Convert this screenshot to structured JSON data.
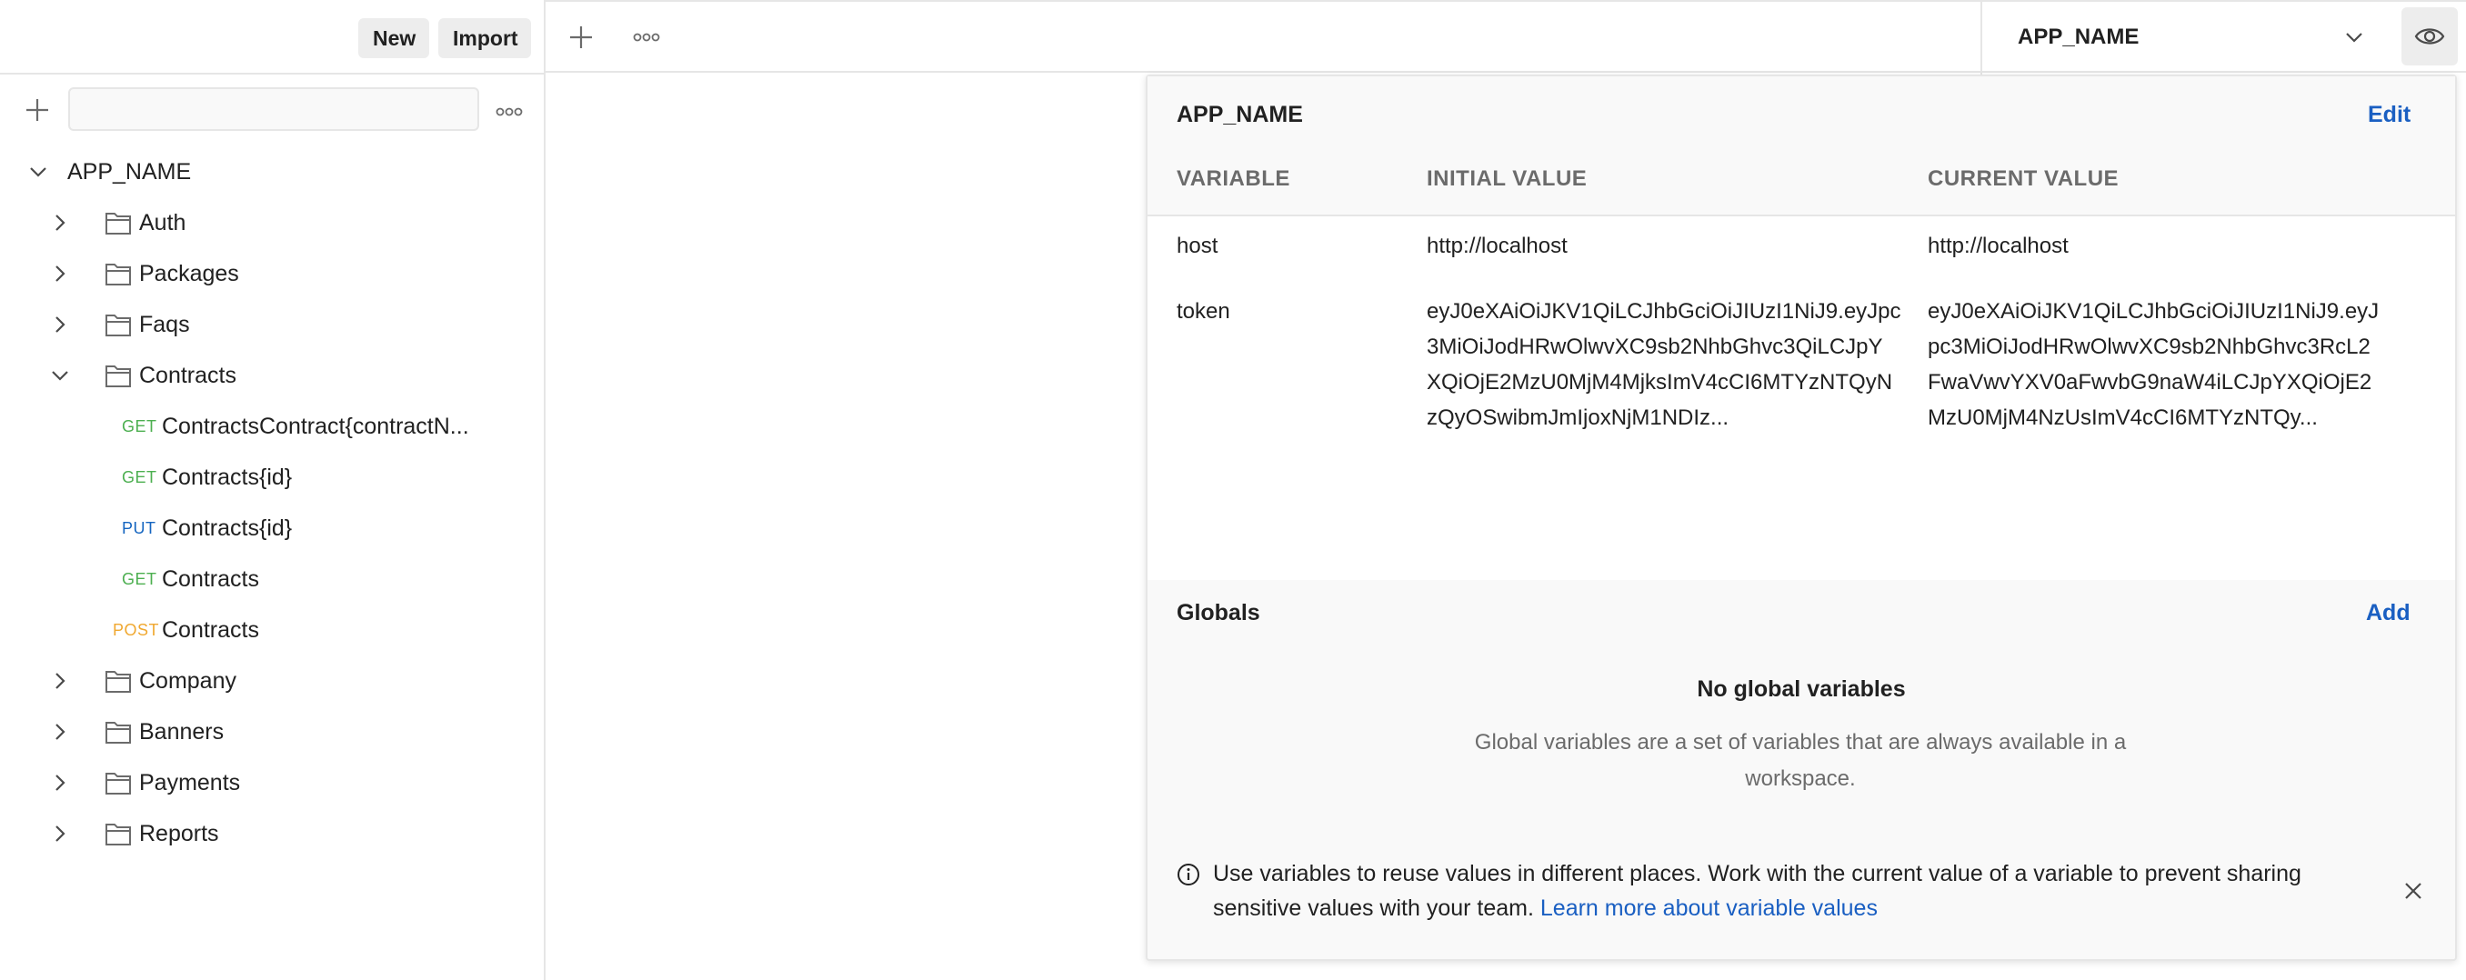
{
  "sidebar": {
    "new_label": "New",
    "import_label": "Import",
    "filter_placeholder": "",
    "collection": {
      "name": "APP_NAME",
      "items": [
        {
          "type": "folder",
          "label": "Auth",
          "expanded": false
        },
        {
          "type": "folder",
          "label": "Packages",
          "expanded": false
        },
        {
          "type": "folder",
          "label": "Faqs",
          "expanded": false
        },
        {
          "type": "folder",
          "label": "Contracts",
          "expanded": true
        },
        {
          "type": "request",
          "method": "GET",
          "label": "ContractsContract{contractN..."
        },
        {
          "type": "request",
          "method": "GET",
          "label": "Contracts{id}"
        },
        {
          "type": "request",
          "method": "PUT",
          "label": "Contracts{id}"
        },
        {
          "type": "request",
          "method": "GET",
          "label": "Contracts"
        },
        {
          "type": "request",
          "method": "POST",
          "label": "Contracts"
        },
        {
          "type": "folder",
          "label": "Company",
          "expanded": false
        },
        {
          "type": "folder",
          "label": "Banners",
          "expanded": false
        },
        {
          "type": "folder",
          "label": "Payments",
          "expanded": false
        },
        {
          "type": "folder",
          "label": "Reports",
          "expanded": false
        }
      ]
    }
  },
  "header": {
    "environment": "APP_NAME"
  },
  "env_panel": {
    "title": "APP_NAME",
    "edit_label": "Edit",
    "columns": [
      "VARIABLE",
      "INITIAL VALUE",
      "CURRENT VALUE"
    ],
    "rows": [
      {
        "variable": "host",
        "initial": "http://localhost",
        "current": "http://localhost"
      },
      {
        "variable": "token",
        "initial": [
          "eyJ0eXAiOiJKV1QiLCJhbGciOiJIUzI1NiJ9.eyJpc",
          "3MiOiJodHRwOlwvXC9sb2NhbGhvc3QiLCJpY",
          "XQiOjE2MzU0MjM4MjksImV4cCI6MTYzNTQyN",
          "zQyOSwibmJmIjoxNjM1NDIz..."
        ],
        "current": [
          "eyJ0eXAiOiJKV1QiLCJhbGciOiJIUzI1NiJ9.eyJ",
          "pc3MiOiJodHRwOlwvXC9sb2NhbGhvc3RcL2",
          "FwaVwvYXV0aFwvbG9naW4iLCJpYXQiOjE2",
          "MzU0MjM4NzUsImV4cCI6MTYzNTQy..."
        ]
      }
    ],
    "globals": {
      "title": "Globals",
      "add_label": "Add",
      "empty_title": "No global variables",
      "empty_desc": "Global variables are a set of variables that are always available in a workspace."
    },
    "info": {
      "text": "Use variables to reuse values in different places. Work with the current value of a variable to prevent sharing sensitive values with your team. ",
      "link": "Learn more about variable values"
    }
  },
  "colors": {
    "accent_link": "#1a5fc2",
    "get": "#4caf50",
    "put": "#1565c0",
    "post": "#f0a830"
  }
}
